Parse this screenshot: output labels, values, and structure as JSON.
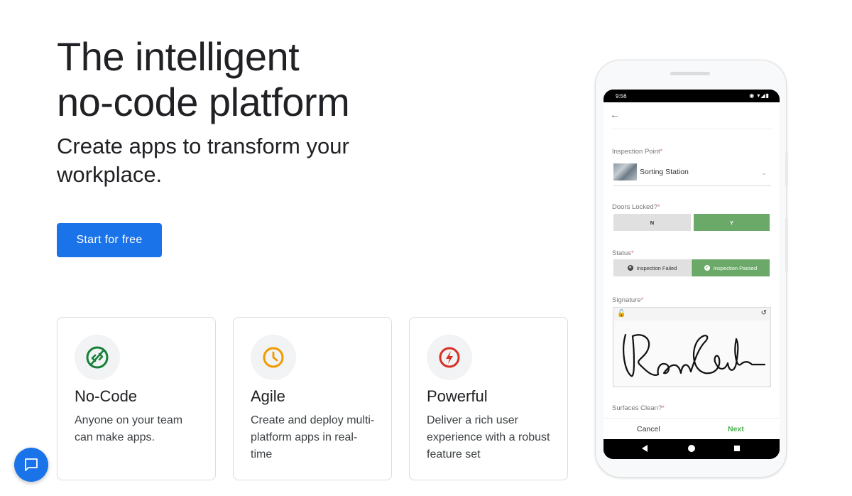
{
  "hero": {
    "title_line1": "The intelligent",
    "title_line2": "no-code platform",
    "subtitle_line1": "Create apps to transform your",
    "subtitle_line2": "workplace.",
    "cta_label": "Start for free"
  },
  "features": [
    {
      "icon": "no-code-icon",
      "color": "#188038",
      "title": "No-Code",
      "desc": "Anyone on your team can make apps."
    },
    {
      "icon": "clock-icon",
      "color": "#f29900",
      "title": "Agile",
      "desc": "Create and deploy multi-platform apps in real-time"
    },
    {
      "icon": "lightning-icon",
      "color": "#d93025",
      "title": "Powerful",
      "desc": "Deliver a rich user experience with a robust feature set"
    }
  ],
  "chat_fab": {
    "icon": "chat-icon",
    "color": "#1a73e8"
  },
  "phone": {
    "status_time": "9:56",
    "status_icons": "◉ ▾◢▮",
    "back_icon": "←",
    "inspection_point": {
      "label": "Inspection Point",
      "value": "Sorting Station",
      "required": "*"
    },
    "doors_locked": {
      "label": "Doors Locked?",
      "required": "*",
      "options": [
        "N",
        "Y"
      ],
      "selected": "Y"
    },
    "status": {
      "label": "Status",
      "required": "*",
      "options": [
        "Inspection Failed",
        "Inspection Passed"
      ],
      "selected": "Inspection Passed"
    },
    "signature": {
      "label": "Signature",
      "required": "*"
    },
    "surfaces_clean": {
      "label": "Surfaces Clean?",
      "required": "*"
    },
    "footer": {
      "cancel": "Cancel",
      "next": "Next"
    },
    "accent_green": "#6aa967"
  }
}
